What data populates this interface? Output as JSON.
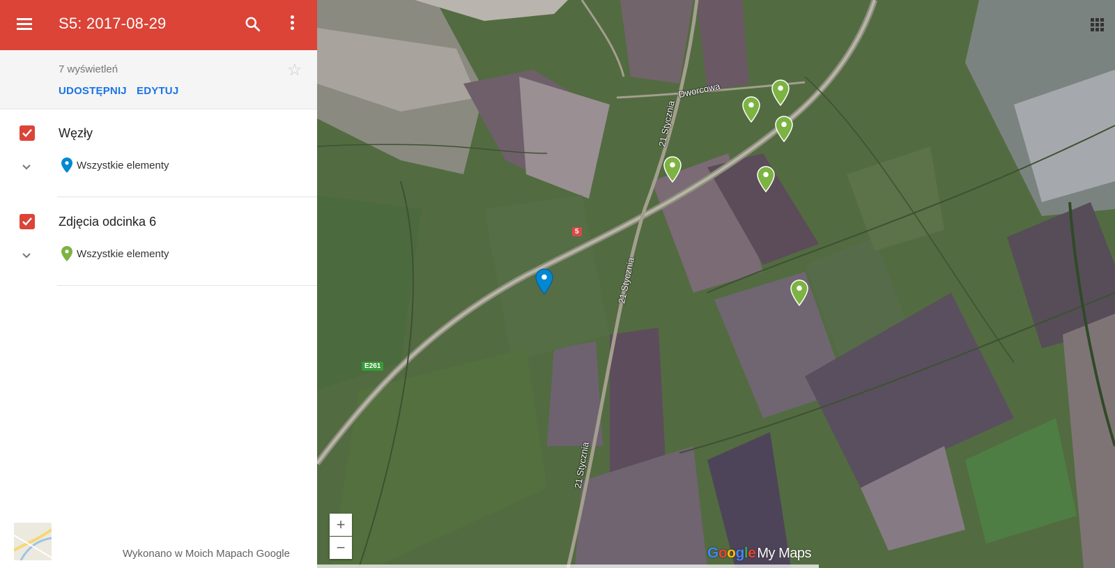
{
  "header": {
    "title": "S5: 2017-08-29"
  },
  "info": {
    "views": "7 wyświetleń",
    "share_label": "UDOSTĘPNIJ",
    "edit_label": "EDYTUJ"
  },
  "layers": [
    {
      "name": "Węzły",
      "items_label": "Wszystkie elementy",
      "pin_color": "#0288d1"
    },
    {
      "name": "Zdjęcia odcinka 6",
      "items_label": "Wszystkie elementy",
      "pin_color": "#7cb342"
    }
  ],
  "footer": {
    "made_with": "Wykonano w Moich Mapach Google"
  },
  "map": {
    "road_labels": [
      "Dworcowa",
      "21 Stycznia",
      "21 Stycznia",
      "21 Stycznia"
    ],
    "shields": [
      {
        "text": "5",
        "color": "#d94a4a"
      },
      {
        "text": "E261",
        "color": "#3a9a3a"
      }
    ],
    "zoom_in": "+",
    "zoom_out": "−",
    "logo_brand": [
      "G",
      "o",
      "o",
      "g",
      "l",
      "e"
    ],
    "logo_product": "My Maps"
  },
  "colors": {
    "header_bg": "#db4437",
    "accent_link": "#1a73e8",
    "pin_blue": "#0288d1",
    "pin_green": "#7cb342"
  }
}
